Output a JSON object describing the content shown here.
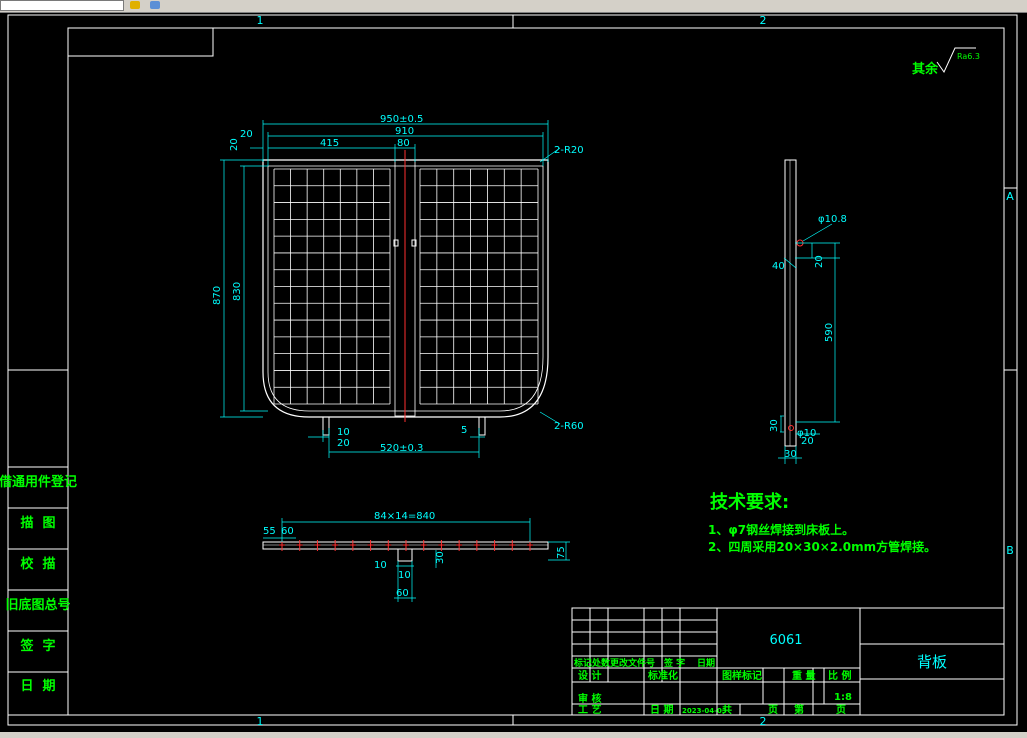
{
  "app": {
    "toolbar_icons": [
      "folder-icon",
      "layer-icon"
    ]
  },
  "colors": {
    "background": "#000000",
    "frame": "#ffffff",
    "dimension": "#00ffff",
    "note": "#00ff00",
    "center": "#ff3030"
  },
  "zones": {
    "col1_top": "1",
    "col2_top": "2",
    "col1_bottom": "1",
    "col2_bottom": "2",
    "row_a": "A",
    "row_b": "B"
  },
  "roughness": {
    "prefix": "其余",
    "value": "Ra6.3"
  },
  "front_view": {
    "dims": {
      "overall_width": "950±0.5",
      "inner_width": "910",
      "left_offset": "20",
      "half_width": "415",
      "center_gap": "80",
      "top_offset": "20",
      "corner_top": "2-R20",
      "overall_height": "870",
      "inner_height": "830",
      "corner_bottom": "2-R60",
      "foot_a": "10",
      "foot_b": "20",
      "foot_c": "5",
      "foot_span": "520±0.3"
    }
  },
  "side_view": {
    "dims": {
      "hole_top": "φ10.8",
      "d_40": "40",
      "d_20": "20",
      "d_590": "590",
      "d_30": "30",
      "hole_bottom": "φ10",
      "d_20b": "20",
      "d_30b": "30"
    }
  },
  "top_view": {
    "dims": {
      "pitch": "84×14=840",
      "d_55": "55",
      "d_60": "60",
      "d_75": "75",
      "d_10": "10",
      "d_30": "30",
      "d_10b": "10",
      "d_60b": "60"
    }
  },
  "notes": {
    "title": "技术要求:",
    "items": [
      "1、φ7钢丝焊接到床板上。",
      "2、四周采用20×30×2.0mm方管焊接。"
    ]
  },
  "side_table": {
    "rows": [
      "借通用件登记",
      "描  图",
      "校  描",
      "旧底图总号",
      "签  字",
      "日  期"
    ]
  },
  "title_block": {
    "material": "6061",
    "part_name": "背板",
    "rev_header": [
      "标记",
      "处数",
      "更改文件号",
      "签 字",
      "日期"
    ],
    "design": "设 计",
    "standard": "标准化",
    "review": "审 核",
    "process": "工 艺",
    "date_label": "日 期",
    "date_value": "2023-04-03",
    "stage_label": "图样标记",
    "weight_label": "重 量",
    "scale_label": "比 例",
    "scale_value": "1:8",
    "total_label": "共",
    "page_label": "页",
    "sheet_label": "第"
  }
}
